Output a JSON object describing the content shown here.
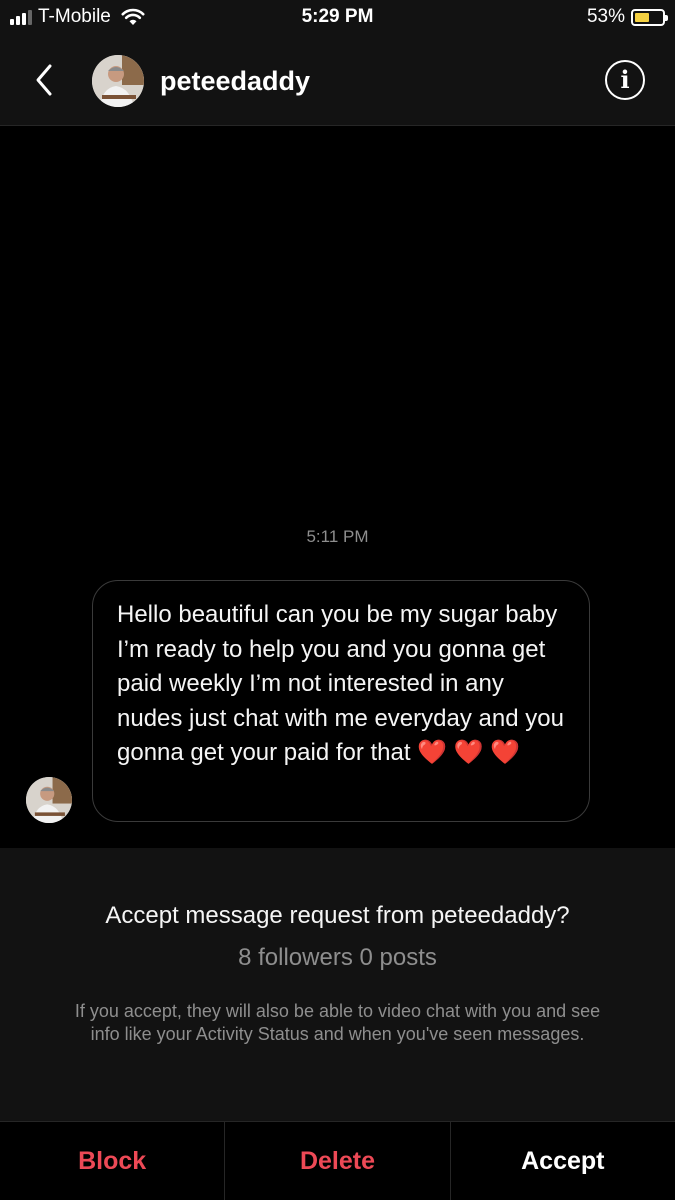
{
  "status_bar": {
    "carrier": "T-Mobile",
    "time": "5:29 PM",
    "battery_percent": "53%",
    "battery_level": 0.53,
    "battery_color": "#f5d142"
  },
  "header": {
    "back_icon": "chevron-left-icon",
    "username": "peteedaddy",
    "info_icon": "info-icon",
    "info_glyph": "i"
  },
  "chat": {
    "timestamp": "5:11 PM",
    "messages": [
      {
        "text": "Hello beautiful can you be my sugar baby I’m ready to help you and you gonna get paid weekly I’m not interested in any nudes just chat with me everyday and you gonna get your paid for that ❤️ ❤️ ❤️"
      }
    ]
  },
  "request": {
    "title": "Accept message request from peteedaddy?",
    "stats": "8 followers 0 posts",
    "info": "If you accept, they will also be able to video chat with you and see info like your Activity Status and when you've seen messages."
  },
  "actions": {
    "block": "Block",
    "delete": "Delete",
    "accept": "Accept",
    "danger_color": "#ed4956"
  }
}
